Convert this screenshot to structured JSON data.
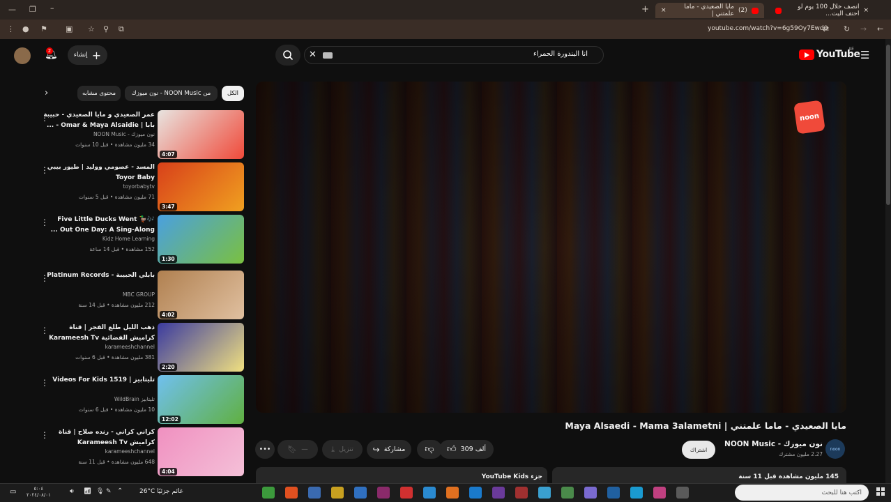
{
  "browser": {
    "tabs": [
      {
        "label": "مايا الصعيدي - ماما علمتني |",
        "count": "(2)",
        "close": "×"
      },
      {
        "label": "انصف خلال 100 يوم لو احتف اليت..."
      }
    ],
    "url": "youtube.com/watch?v=6g59Oy7Ewd0"
  },
  "header": {
    "logo_text": "YouTube",
    "region": "AE",
    "search_value": "انا البندورة الحمراء",
    "create_label": "إنشاء",
    "notification_count": "2"
  },
  "chips": [
    {
      "label": "الكل",
      "selected": true
    },
    {
      "label": "من NOON Music - نون ميوزك",
      "selected": false
    },
    {
      "label": "محتوى مشابه",
      "selected": false
    }
  ],
  "recommendations": [
    {
      "title": "عمر الصعيدي و مايا الصعيدي - حبيبة بابا | Omar & Maya Alsaidie - ...",
      "channel": "نون ميوزك - NOON Music",
      "meta": "34 مليون مشاهدة • قبل 10 سنوات",
      "duration": "4:07",
      "thumb_colors": [
        "#e8e4e0",
        "#f04a3a"
      ]
    },
    {
      "title": "المسد - عصومي ووليد | طيور بيبي Toyor Baby",
      "channel": "toyorbabytv",
      "meta": "71 مليون مشاهدة • قبل 5 سنوات",
      "duration": "3:47",
      "thumb_colors": [
        "#d8401a",
        "#f0a020"
      ]
    },
    {
      "title": "🎶🦆 Five Little Ducks Went Out One Day: A Sing-Along ...",
      "channel": "Kidz Home Learning",
      "meta": "152 مشاهدة • قبل 14 ساعة",
      "duration": "1:30",
      "thumb_colors": [
        "#4aa0e0",
        "#7ac040"
      ]
    },
    {
      "title": "بابلي الحبيبة - Platinum Records",
      "channel": "MBC GROUP",
      "meta": "212 مليون مشاهدة • قبل 14 سنة",
      "duration": "4:02",
      "thumb_colors": [
        "#b08050",
        "#e0c0a0"
      ]
    },
    {
      "title": "ذهب الليل طلع الفجر | قناة كراميش الفضائية Karameesh Tv",
      "channel": "karameeshchannel",
      "meta": "381 مليون مشاهدة • قبل 6 سنوات",
      "duration": "2:20",
      "thumb_colors": [
        "#3a3aa0",
        "#f0e080"
      ]
    },
    {
      "title": "تليتابيز | Videos For Kids 1519",
      "channel": "تليتابيز WildBrain",
      "meta": "10 مليون مشاهدة • قبل 6 سنوات",
      "duration": "12:02",
      "thumb_colors": [
        "#70c0f0",
        "#60b040"
      ]
    },
    {
      "title": "كراني كراني - رنده صلاح | قناة كراميش Karameesh Tv",
      "channel": "karameeshchannel",
      "meta": "648 مليون مشاهدة • قبل 11 سنة",
      "duration": "4:04",
      "thumb_colors": [
        "#f090c0",
        "#f4c0d8"
      ]
    }
  ],
  "video": {
    "title": "مايا الصعيدي - ماما علمتني | Maya Alsaedi - Mama 3alametni",
    "channel": "نون ميوزك - NOON Music",
    "subscribers": "2.27 مليون مشترك",
    "subscribe_label": "اشتراك",
    "likes": "309 ألف",
    "share_label": "مشاركة",
    "download_label": "تنزيل",
    "views_line": "145 مليون مشاهدة  قبل 11 سنة",
    "kids_label": "جزء YouTube Kids",
    "channel_badge": "noon"
  },
  "taskbar": {
    "search_placeholder": "اكتب هنا للبحث",
    "weather": "26°C  غائم جزئيًا",
    "time": "٥:٠٤",
    "date": "٢٠٢٤/٠٨/٠١"
  }
}
